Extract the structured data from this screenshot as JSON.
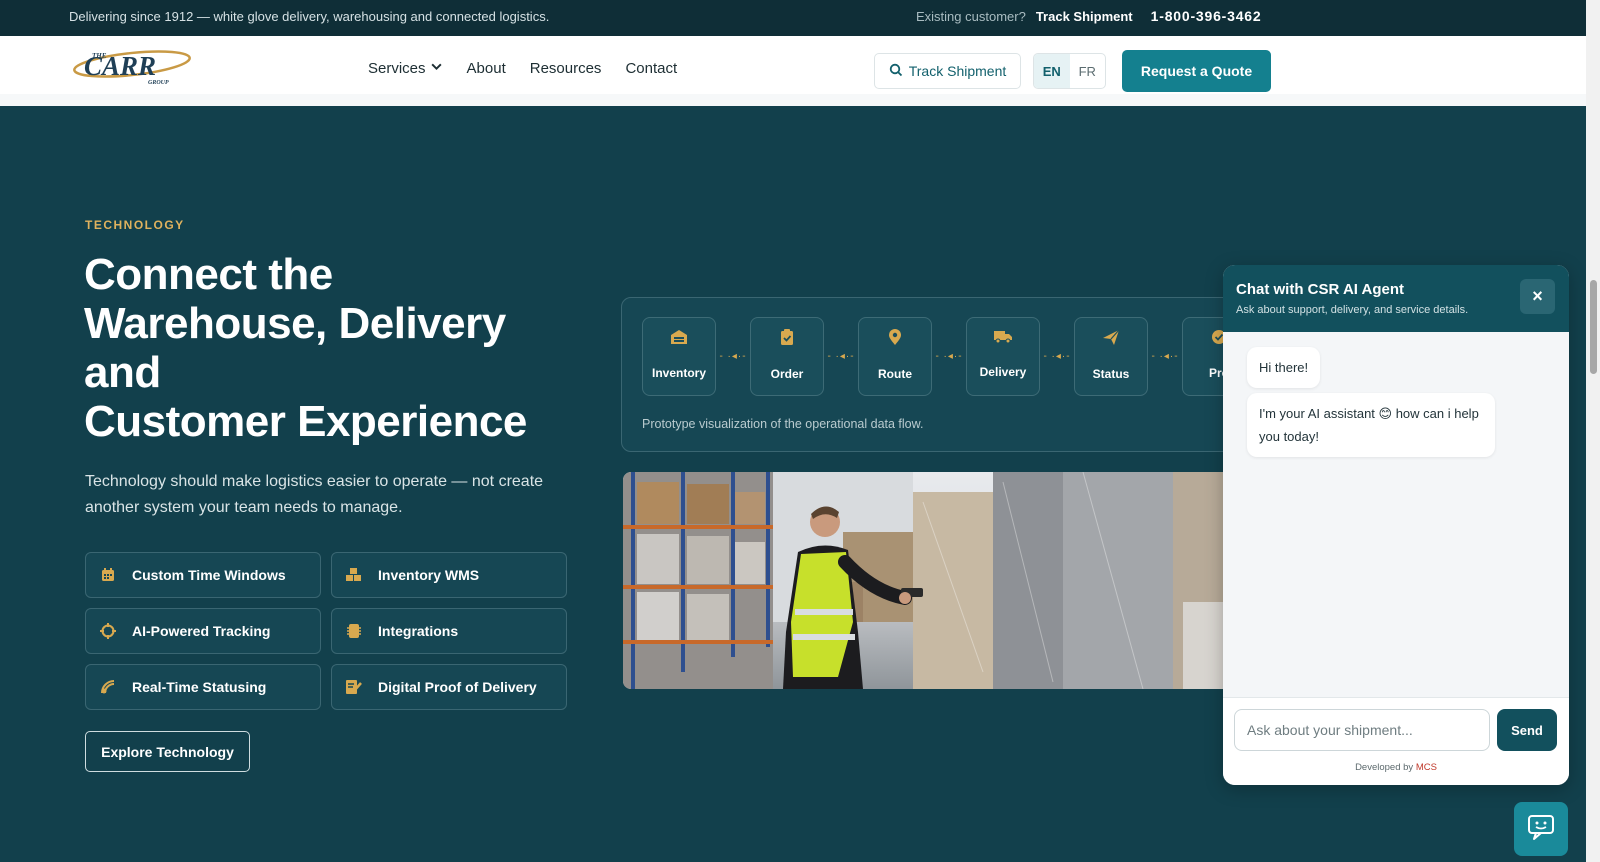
{
  "topbar": {
    "tagline": "Delivering since 1912 — white glove delivery, warehousing and connected logistics.",
    "existing_label": "Existing customer?",
    "track_link": "Track Shipment",
    "phone": "1-800-396-3462"
  },
  "header": {
    "logo": {
      "the": "THE",
      "name": "CARR",
      "group": "GROUP"
    },
    "nav": [
      {
        "label": "Services",
        "has_dropdown": true
      },
      {
        "label": "About"
      },
      {
        "label": "Resources"
      },
      {
        "label": "Contact"
      }
    ],
    "track_button": "Track Shipment",
    "languages": [
      "EN",
      "FR"
    ],
    "active_language": "EN",
    "quote_button": "Request a Quote"
  },
  "hero": {
    "eyebrow": "TECHNOLOGY",
    "title_lines": [
      "Connect the",
      "Warehouse, Delivery",
      "and",
      "Customer Experience"
    ],
    "description": "Technology should make logistics easier to operate — not create another system your team needs to manage.",
    "features": [
      {
        "label": "Custom Time Windows",
        "icon": "calendar-icon"
      },
      {
        "label": "Inventory WMS",
        "icon": "boxes-icon"
      },
      {
        "label": "AI-Powered Tracking",
        "icon": "crosshair-icon"
      },
      {
        "label": "Integrations",
        "icon": "plug-icon"
      },
      {
        "label": "Real-Time Statusing",
        "icon": "satellite-icon"
      },
      {
        "label": "Digital Proof of Delivery",
        "icon": "signature-icon"
      }
    ],
    "explore_button": "Explore Technology"
  },
  "flow": {
    "steps": [
      {
        "label": "Inventory",
        "icon": "warehouse-icon"
      },
      {
        "label": "Order",
        "icon": "clipboard-check-icon"
      },
      {
        "label": "Route",
        "icon": "map-pin-icon"
      },
      {
        "label": "Delivery",
        "icon": "truck-icon"
      },
      {
        "label": "Status",
        "icon": "paper-plane-icon"
      },
      {
        "label": "Pro",
        "icon": "check-circle-icon"
      }
    ],
    "caption": "Prototype visualization of the operational data flow."
  },
  "chat": {
    "title": "Chat with CSR AI Agent",
    "subtitle": "Ask about support, delivery, and service details.",
    "close": "×",
    "messages": [
      "Hi there!",
      "I'm your AI assistant 😊 how can i help you today!"
    ],
    "input_placeholder": "Ask about your shipment...",
    "send_button": "Send",
    "developed_by": "Developed by",
    "developer": "MCS"
  },
  "colors": {
    "hero_bg": "#12404c",
    "topbar_bg": "#0f2e37",
    "accent_teal": "#14808f",
    "eyebrow_gold": "#e0b25e",
    "chat_header": "#12505d"
  }
}
